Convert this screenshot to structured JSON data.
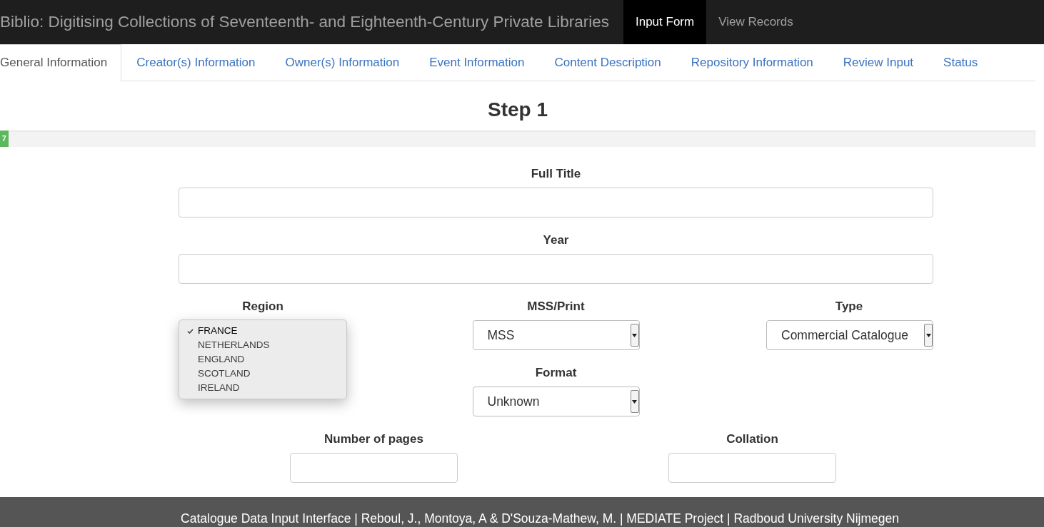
{
  "navbar": {
    "title": "Biblio: Digitising Collections of Seventeenth- and Eighteenth-Century Private Libraries",
    "links": [
      {
        "label": "Input Form",
        "selected": true
      },
      {
        "label": "View Records",
        "selected": false
      }
    ]
  },
  "tabs": [
    {
      "label": "General Information",
      "selected": true
    },
    {
      "label": "Creator(s) Information",
      "selected": false
    },
    {
      "label": "Owner(s) Information",
      "selected": false
    },
    {
      "label": "Event Information",
      "selected": false
    },
    {
      "label": "Content Description",
      "selected": false
    },
    {
      "label": "Repository Information",
      "selected": false
    },
    {
      "label": "Review Input",
      "selected": false
    },
    {
      "label": "Status",
      "selected": false
    }
  ],
  "heading": "Step 1",
  "progress": {
    "level": 0.008,
    "label": "7"
  },
  "form": {
    "full_title": {
      "label": "Full Title"
    },
    "year": {
      "label": "Year"
    },
    "region": {
      "label": "Region",
      "expanded": true,
      "options": [
        {
          "label": "FRANCE",
          "selected": true
        },
        {
          "label": "NETHERLANDS",
          "selected": false
        },
        {
          "label": "ENGLAND",
          "selected": false
        },
        {
          "label": "SCOTLAND",
          "selected": false
        },
        {
          "label": "IRELAND",
          "selected": false
        }
      ]
    },
    "mss_print": {
      "label": "MSS/Print",
      "value": "MSS"
    },
    "type": {
      "label": "Type",
      "value": "Commercial Catalogue"
    },
    "format": {
      "label": "Format",
      "value": "Unknown"
    },
    "number_of_pages": {
      "label": "Number of pages"
    },
    "collation": {
      "label": "Collation"
    }
  },
  "footer": "Catalogue Data Input Interface | Reboul, J., Montoya, A & D'Souza-Mathew, M. | MEDIATE Project | Radboud University Nijmegen"
}
